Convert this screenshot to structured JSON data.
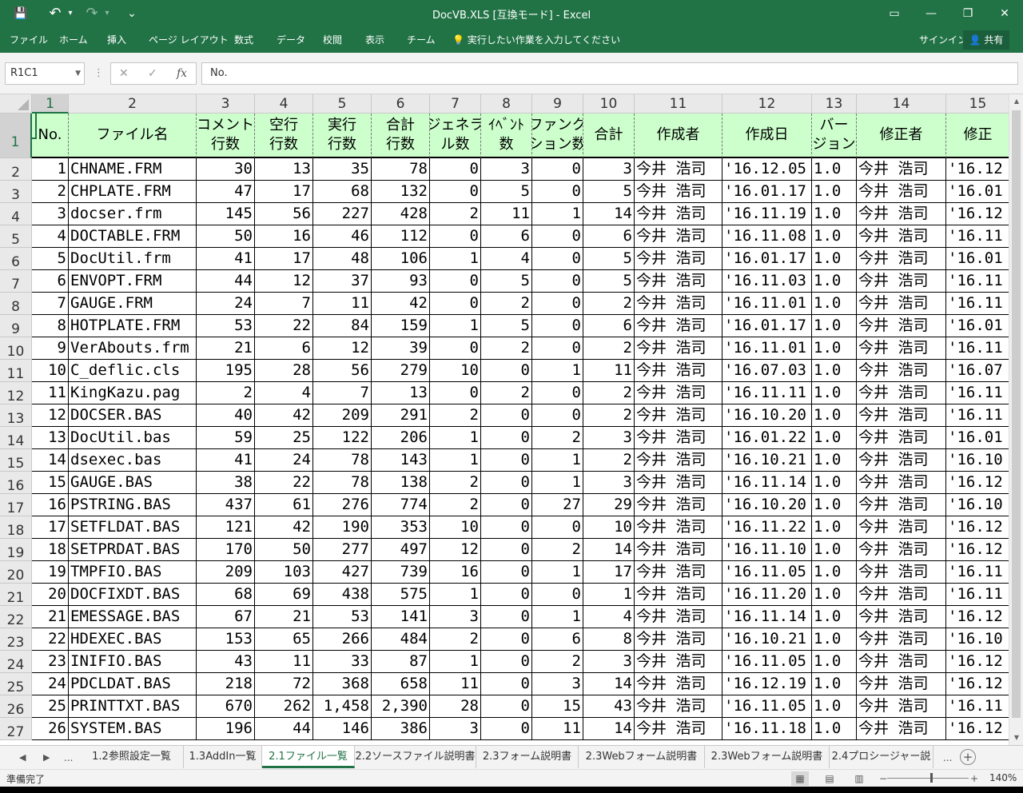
{
  "window": {
    "title": "DocVB.XLS  [互換モード] - Excel",
    "qa_save": "💾",
    "qa_undo": "↶",
    "qa_redo": "↷",
    "qa_customize": "⌄",
    "ribbon_display": "▭",
    "minimize": "—",
    "restore": "❐",
    "close": "✕"
  },
  "ribbon": {
    "tabs": [
      "ファイル",
      "ホーム",
      "挿入",
      "ページ レイアウト",
      "数式",
      "データ",
      "校閲",
      "表示",
      "チーム"
    ],
    "tellme": "実行したい作業を入力してください",
    "signin": "サインイン",
    "share": "共有"
  },
  "formula_bar": {
    "name_box": "R1C1",
    "dots": "⋮",
    "cancel": "✕",
    "enter": "✓",
    "fx": "fx",
    "content": "No."
  },
  "grid": {
    "col_headers": [
      "1",
      "2",
      "3",
      "4",
      "5",
      "6",
      "7",
      "8",
      "9",
      "10",
      "11",
      "12",
      "13",
      "14",
      "15"
    ],
    "row_headers": [
      "1",
      "2",
      "3",
      "4",
      "5",
      "6",
      "7",
      "8",
      "9",
      "10",
      "11",
      "12",
      "13",
      "14",
      "15",
      "16",
      "17",
      "18",
      "19",
      "20",
      "21",
      "22",
      "23",
      "24",
      "25",
      "26",
      "27"
    ],
    "header_row": [
      "No.",
      "ファイル名",
      "コメント\n行数",
      "空行\n行数",
      "実行\n行数",
      "合計\n行数",
      "ジェネラ\nル数",
      "ｲﾍﾞﾝﾄ\n数",
      "ファンク\nション数",
      "合計",
      "作成者",
      "作成日",
      "バー\nジョン",
      "修正者",
      "修正"
    ],
    "rows": [
      [
        "1",
        "CHNAME.FRM",
        "30",
        "13",
        "35",
        "78",
        "0",
        "3",
        "0",
        "3",
        "今井 浩司",
        "'16.12.05",
        "1.0",
        "今井 浩司",
        "'16.12"
      ],
      [
        "2",
        "CHPLATE.FRM",
        "47",
        "17",
        "68",
        "132",
        "0",
        "5",
        "0",
        "5",
        "今井 浩司",
        "'16.01.17",
        "1.0",
        "今井 浩司",
        "'16.01"
      ],
      [
        "3",
        "docser.frm",
        "145",
        "56",
        "227",
        "428",
        "2",
        "11",
        "1",
        "14",
        "今井 浩司",
        "'16.11.19",
        "1.0",
        "今井 浩司",
        "'16.12"
      ],
      [
        "4",
        "DOCTABLE.FRM",
        "50",
        "16",
        "46",
        "112",
        "0",
        "6",
        "0",
        "6",
        "今井 浩司",
        "'16.11.08",
        "1.0",
        "今井 浩司",
        "'16.11"
      ],
      [
        "5",
        "DocUtil.frm",
        "41",
        "17",
        "48",
        "106",
        "1",
        "4",
        "0",
        "5",
        "今井 浩司",
        "'16.01.17",
        "1.0",
        "今井 浩司",
        "'16.01"
      ],
      [
        "6",
        "ENVOPT.FRM",
        "44",
        "12",
        "37",
        "93",
        "0",
        "5",
        "0",
        "5",
        "今井 浩司",
        "'16.11.03",
        "1.0",
        "今井 浩司",
        "'16.11"
      ],
      [
        "7",
        "GAUGE.FRM",
        "24",
        "7",
        "11",
        "42",
        "0",
        "2",
        "0",
        "2",
        "今井 浩司",
        "'16.11.01",
        "1.0",
        "今井 浩司",
        "'16.11"
      ],
      [
        "8",
        "HOTPLATE.FRM",
        "53",
        "22",
        "84",
        "159",
        "1",
        "5",
        "0",
        "6",
        "今井 浩司",
        "'16.01.17",
        "1.0",
        "今井 浩司",
        "'16.01"
      ],
      [
        "9",
        "VerAbouts.frm",
        "21",
        "6",
        "12",
        "39",
        "0",
        "2",
        "0",
        "2",
        "今井 浩司",
        "'16.11.01",
        "1.0",
        "今井 浩司",
        "'16.11"
      ],
      [
        "10",
        "C_deflic.cls",
        "195",
        "28",
        "56",
        "279",
        "10",
        "0",
        "1",
        "11",
        "今井 浩司",
        "'16.07.03",
        "1.0",
        "今井 浩司",
        "'16.07"
      ],
      [
        "11",
        "KingKazu.pag",
        "2",
        "4",
        "7",
        "13",
        "0",
        "2",
        "0",
        "2",
        "今井 浩司",
        "'16.11.11",
        "1.0",
        "今井 浩司",
        "'16.11"
      ],
      [
        "12",
        "DOCSER.BAS",
        "40",
        "42",
        "209",
        "291",
        "2",
        "0",
        "0",
        "2",
        "今井 浩司",
        "'16.10.20",
        "1.0",
        "今井 浩司",
        "'16.11"
      ],
      [
        "13",
        "DocUtil.bas",
        "59",
        "25",
        "122",
        "206",
        "1",
        "0",
        "2",
        "3",
        "今井 浩司",
        "'16.01.22",
        "1.0",
        "今井 浩司",
        "'16.01"
      ],
      [
        "14",
        "dsexec.bas",
        "41",
        "24",
        "78",
        "143",
        "1",
        "0",
        "1",
        "2",
        "今井 浩司",
        "'16.10.21",
        "1.0",
        "今井 浩司",
        "'16.10"
      ],
      [
        "15",
        "GAUGE.BAS",
        "38",
        "22",
        "78",
        "138",
        "2",
        "0",
        "1",
        "3",
        "今井 浩司",
        "'16.11.14",
        "1.0",
        "今井 浩司",
        "'16.12"
      ],
      [
        "16",
        "PSTRING.BAS",
        "437",
        "61",
        "276",
        "774",
        "2",
        "0",
        "27",
        "29",
        "今井 浩司",
        "'16.10.20",
        "1.0",
        "今井 浩司",
        "'16.10"
      ],
      [
        "17",
        "SETFLDAT.BAS",
        "121",
        "42",
        "190",
        "353",
        "10",
        "0",
        "0",
        "10",
        "今井 浩司",
        "'16.11.22",
        "1.0",
        "今井 浩司",
        "'16.12"
      ],
      [
        "18",
        "SETPRDAT.BAS",
        "170",
        "50",
        "277",
        "497",
        "12",
        "0",
        "2",
        "14",
        "今井 浩司",
        "'16.11.10",
        "1.0",
        "今井 浩司",
        "'16.12"
      ],
      [
        "19",
        "TMPFIO.BAS",
        "209",
        "103",
        "427",
        "739",
        "16",
        "0",
        "1",
        "17",
        "今井 浩司",
        "'16.11.05",
        "1.0",
        "今井 浩司",
        "'16.11"
      ],
      [
        "20",
        "DOCFIXDT.BAS",
        "68",
        "69",
        "438",
        "575",
        "1",
        "0",
        "0",
        "1",
        "今井 浩司",
        "'16.11.20",
        "1.0",
        "今井 浩司",
        "'16.11"
      ],
      [
        "21",
        "EMESSAGE.BAS",
        "67",
        "21",
        "53",
        "141",
        "3",
        "0",
        "1",
        "4",
        "今井 浩司",
        "'16.11.14",
        "1.0",
        "今井 浩司",
        "'16.12"
      ],
      [
        "22",
        "HDEXEC.BAS",
        "153",
        "65",
        "266",
        "484",
        "2",
        "0",
        "6",
        "8",
        "今井 浩司",
        "'16.10.21",
        "1.0",
        "今井 浩司",
        "'16.10"
      ],
      [
        "23",
        "INIFIO.BAS",
        "43",
        "11",
        "33",
        "87",
        "1",
        "0",
        "2",
        "3",
        "今井 浩司",
        "'16.11.05",
        "1.0",
        "今井 浩司",
        "'16.12"
      ],
      [
        "24",
        "PDCLDAT.BAS",
        "218",
        "72",
        "368",
        "658",
        "11",
        "0",
        "3",
        "14",
        "今井 浩司",
        "'16.12.19",
        "1.0",
        "今井 浩司",
        "'16.12"
      ],
      [
        "25",
        "PRINTTXT.BAS",
        "670",
        "262",
        "1,458",
        "2,390",
        "28",
        "0",
        "15",
        "43",
        "今井 浩司",
        "'16.11.05",
        "1.0",
        "今井 浩司",
        "'16.11"
      ],
      [
        "26",
        "SYSTEM.BAS",
        "196",
        "44",
        "146",
        "386",
        "3",
        "0",
        "11",
        "14",
        "今井 浩司",
        "'16.11.18",
        "1.0",
        "今井 浩司",
        "'16.12"
      ]
    ]
  },
  "sheet_tabs": {
    "nav_prev": "◀",
    "nav_next": "▶",
    "nav_more": "...",
    "tabs": [
      "1.2参照設定一覧",
      "1.3AddIn一覧",
      "2.1ファイル一覧",
      "2.2ソースファイル説明書",
      "2.3フォーム説明書",
      "2.3Webフォーム説明書",
      "2.3Webフォーム説明書",
      "2.4プロシージャー説"
    ],
    "active_index": 2,
    "more_right": "...",
    "add": "+"
  },
  "status_bar": {
    "ready": "準備完了",
    "zoom": "140%",
    "zoom_minus": "−",
    "zoom_plus": "+",
    "zoom_level": 0.53
  }
}
